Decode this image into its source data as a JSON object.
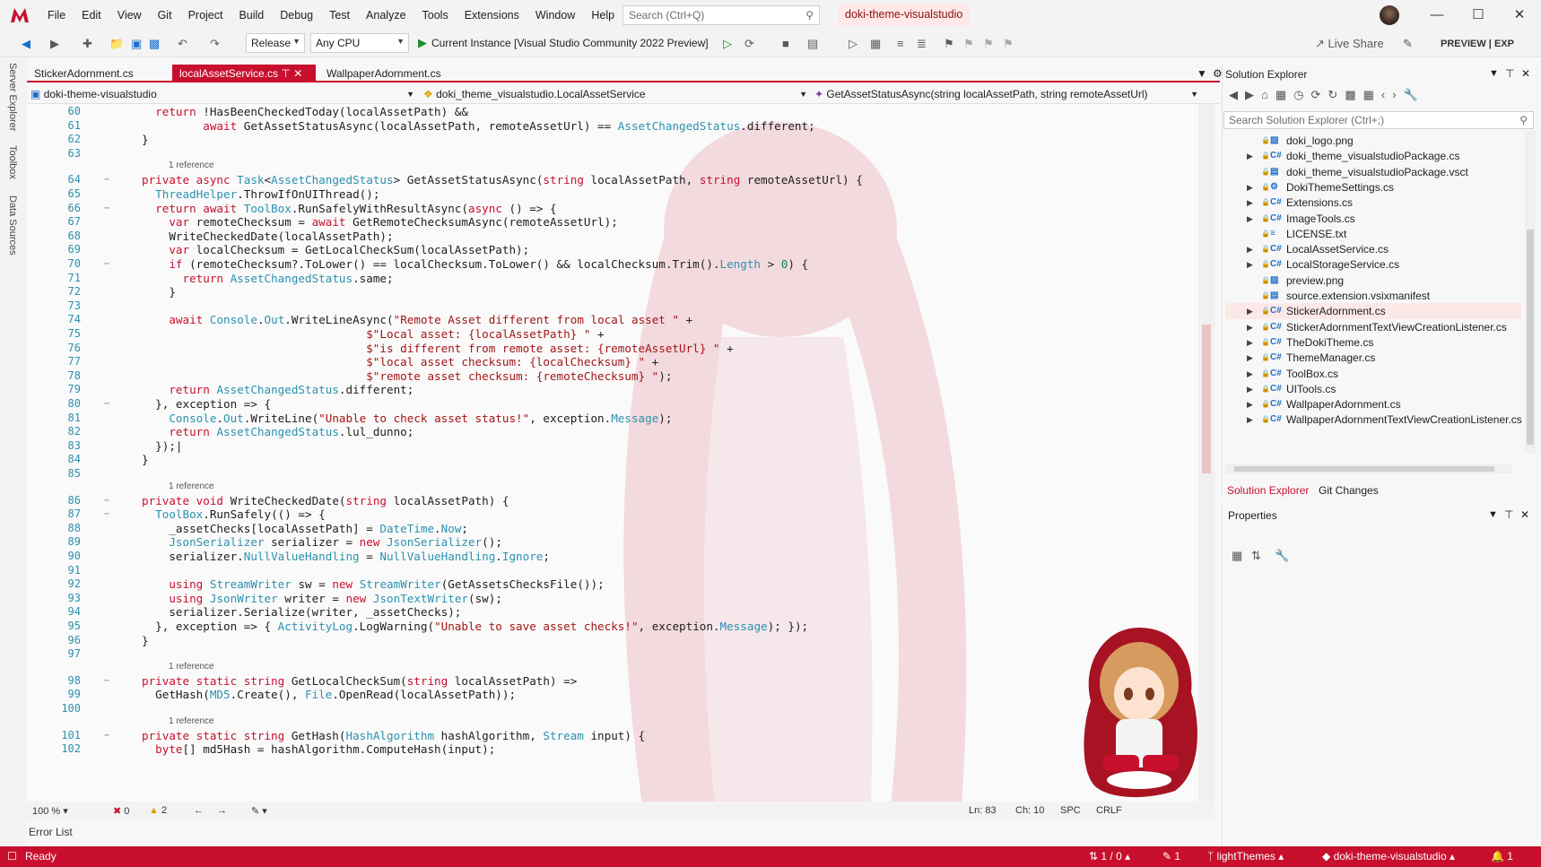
{
  "menu": [
    "File",
    "Edit",
    "View",
    "Git",
    "Project",
    "Build",
    "Debug",
    "Test",
    "Analyze",
    "Tools",
    "Extensions",
    "Window",
    "Help"
  ],
  "search": {
    "placeholder": "Search (Ctrl+Q)"
  },
  "solution_name": "doki-theme-visualstudio",
  "toolbar": {
    "config": "Release",
    "platform": "Any CPU",
    "run_target": "Current Instance [Visual Studio Community 2022 Preview]",
    "live_share": "Live Share",
    "preview": "PREVIEW",
    "exp": "EXP"
  },
  "left_tabs": [
    "Server Explorer",
    "Toolbox",
    "Data Sources"
  ],
  "doc_tabs": [
    {
      "label": "StickerAdornment.cs",
      "active": false
    },
    {
      "label": "localAssetService.cs",
      "active": true
    },
    {
      "label": "WallpaperAdornment.cs",
      "active": false
    }
  ],
  "navbar": {
    "project": "doki-theme-visualstudio",
    "type": "doki_theme_visualstudio.LocalAssetService",
    "member": "GetAssetStatusAsync(string localAssetPath, string remoteAssetUrl)"
  },
  "code_lines": [
    {
      "n": "60",
      "html": "  <span class='kw'>return</span> !HasBeenCheckedToday(localAssetPath) &amp;&amp;"
    },
    {
      "n": "61",
      "html": "         <span class='kw'>await</span> GetAssetStatusAsync(localAssetPath, remoteAssetUrl) == <span class='ty'>AssetChangedStatus</span>.different;"
    },
    {
      "n": "62",
      "html": "}"
    },
    {
      "n": "63",
      "html": ""
    },
    {
      "n": "64",
      "ref": "1 reference",
      "fold": true,
      "html": "<span class='kw'>private async</span> <span class='ty'>Task</span>&lt;<span class='ty'>AssetChangedStatus</span>&gt; GetAssetStatusAsync(<span class='kw'>string</span> localAssetPath, <span class='kw'>string</span> remoteAssetUrl) {"
    },
    {
      "n": "65",
      "html": "  <span class='ty'>ThreadHelper</span>.ThrowIfOnUIThread();"
    },
    {
      "n": "66",
      "fold": true,
      "html": "  <span class='kw'>return await</span> <span class='ty'>ToolBox</span>.RunSafelyWithResultAsync(<span class='kw'>async</span> () =&gt; {"
    },
    {
      "n": "67",
      "html": "    <span class='kw'>var</span> remoteChecksum = <span class='kw'>await</span> GetRemoteChecksumAsync(remoteAssetUrl);"
    },
    {
      "n": "68",
      "html": "    WriteCheckedDate(localAssetPath);"
    },
    {
      "n": "69",
      "html": "    <span class='kw'>var</span> localChecksum = GetLocalCheckSum(localAssetPath);"
    },
    {
      "n": "70",
      "fold": true,
      "html": "    <span class='kw'>if</span> (remoteChecksum?.ToLower() == localChecksum.ToLower() &amp;&amp; localChecksum.Trim().<span class='ty'>Length</span> &gt; <span class='num'>0</span>) {"
    },
    {
      "n": "71",
      "html": "      <span class='kw'>return</span> <span class='ty'>AssetChangedStatus</span>.same;"
    },
    {
      "n": "72",
      "html": "    }"
    },
    {
      "n": "73",
      "html": ""
    },
    {
      "n": "74",
      "html": "    <span class='kw'>await</span> <span class='ty'>Console</span>.<span class='ty'>Out</span>.WriteLineAsync(<span class='str'>\"Remote Asset different from local asset \"</span> +"
    },
    {
      "n": "75",
      "html": "                                 <span class='str'>$\"Local asset: {localAssetPath} \"</span> +"
    },
    {
      "n": "76",
      "html": "                                 <span class='str'>$\"is different from remote asset: {remoteAssetUrl} \"</span> +"
    },
    {
      "n": "77",
      "html": "                                 <span class='str'>$\"local asset checksum: {localChecksum} \"</span> +"
    },
    {
      "n": "78",
      "html": "                                 <span class='str'>$\"remote asset checksum: {remoteChecksum} \"</span>);"
    },
    {
      "n": "79",
      "html": "    <span class='kw'>return</span> <span class='ty'>AssetChangedStatus</span>.different;"
    },
    {
      "n": "80",
      "fold": true,
      "html": "  }, exception =&gt; {"
    },
    {
      "n": "81",
      "html": "    <span class='ty'>Console</span>.<span class='ty'>Out</span>.WriteLine(<span class='str'>\"Unable to check asset status!\"</span>, exception.<span class='ty'>Message</span>);"
    },
    {
      "n": "82",
      "html": "    <span class='kw'>return</span> <span class='ty'>AssetChangedStatus</span>.lul_dunno;"
    },
    {
      "n": "83",
      "html": "  });|"
    },
    {
      "n": "84",
      "html": "}"
    },
    {
      "n": "85",
      "html": ""
    },
    {
      "n": "86",
      "ref": "1 reference",
      "fold": true,
      "html": "<span class='kw'>private void</span> WriteCheckedDate(<span class='kw'>string</span> localAssetPath) {"
    },
    {
      "n": "87",
      "fold": true,
      "html": "  <span class='ty'>ToolBox</span>.RunSafely(() =&gt; {"
    },
    {
      "n": "88",
      "html": "    _assetChecks[localAssetPath] = <span class='ty'>DateTime</span>.<span class='ty'>Now</span>;"
    },
    {
      "n": "89",
      "html": "    <span class='ty'>JsonSerializer</span> serializer = <span class='kw'>new</span> <span class='ty'>JsonSerializer</span>();"
    },
    {
      "n": "90",
      "html": "    serializer.<span class='ty'>NullValueHandling</span> = <span class='ty'>NullValueHandling</span>.<span class='ty'>Ignore</span>;"
    },
    {
      "n": "91",
      "html": ""
    },
    {
      "n": "92",
      "html": "    <span class='kw'>using</span> <span class='ty'>StreamWriter</span> sw = <span class='kw'>new</span> <span class='ty'>StreamWriter</span>(GetAssetsChecksFile());"
    },
    {
      "n": "93",
      "html": "    <span class='kw'>using</span> <span class='ty'>JsonWriter</span> writer = <span class='kw'>new</span> <span class='ty'>JsonTextWriter</span>(sw);"
    },
    {
      "n": "94",
      "html": "    serializer.Serialize(writer, _assetChecks);"
    },
    {
      "n": "95",
      "html": "  }, exception =&gt; { <span class='ty'>ActivityLog</span>.LogWarning(<span class='str'>\"Unable to save asset checks!\"</span>, exception.<span class='ty'>Message</span>); });"
    },
    {
      "n": "96",
      "html": "}"
    },
    {
      "n": "97",
      "html": ""
    },
    {
      "n": "98",
      "ref": "1 reference",
      "fold": true,
      "html": "<span class='kw'>private static string</span> GetLocalCheckSum(<span class='kw'>string</span> localAssetPath) =&gt;"
    },
    {
      "n": "99",
      "html": "  GetHash(<span class='ty'>MD5</span>.Create(), <span class='ty'>File</span>.OpenRead(localAssetPath));"
    },
    {
      "n": "100",
      "html": ""
    },
    {
      "n": "101",
      "ref": "1 reference",
      "fold": true,
      "html": "<span class='kw'>private static string</span> GetHash(<span class='ty'>HashAlgorithm</span> hashAlgorithm, <span class='ty'>Stream</span> input) {"
    },
    {
      "n": "102",
      "html": "  <span class='kw'>byte</span>[] md5Hash = hashAlgorithm.ComputeHash(input);"
    }
  ],
  "editor_status": {
    "zoom": "100 %",
    "errors": "0",
    "warnings": "2",
    "line": "Ln: 83",
    "col": "Ch: 10",
    "spc": "SPC",
    "crlf": "CRLF"
  },
  "error_list_tab": "Error List",
  "solution_explorer": {
    "title": "Solution Explorer",
    "search_placeholder": "Search Solution Explorer (Ctrl+;)",
    "items": [
      {
        "name": "doki_logo.png",
        "icon": "image",
        "expandable": false
      },
      {
        "name": "doki_theme_visualstudioPackage.cs",
        "icon": "cs",
        "expandable": true
      },
      {
        "name": "doki_theme_visualstudioPackage.vsct",
        "icon": "vsct",
        "expandable": false
      },
      {
        "name": "DokiThemeSettings.cs",
        "icon": "settings",
        "expandable": true
      },
      {
        "name": "Extensions.cs",
        "icon": "cs",
        "expandable": true
      },
      {
        "name": "ImageTools.cs",
        "icon": "cs",
        "expandable": true
      },
      {
        "name": "LICENSE.txt",
        "icon": "txt",
        "expandable": false
      },
      {
        "name": "LocalAssetService.cs",
        "icon": "cs",
        "expandable": true
      },
      {
        "name": "LocalStorageService.cs",
        "icon": "cs",
        "expandable": true
      },
      {
        "name": "preview.png",
        "icon": "image",
        "expandable": false
      },
      {
        "name": "source.extension.vsixmanifest",
        "icon": "manifest",
        "expandable": false
      },
      {
        "name": "StickerAdornment.cs",
        "icon": "cs",
        "expandable": true,
        "selected": true
      },
      {
        "name": "StickerAdornmentTextViewCreationListener.cs",
        "icon": "cs",
        "expandable": true
      },
      {
        "name": "TheDokiTheme.cs",
        "icon": "cs",
        "expandable": true
      },
      {
        "name": "ThemeManager.cs",
        "icon": "cs",
        "expandable": true
      },
      {
        "name": "ToolBox.cs",
        "icon": "cs",
        "expandable": true
      },
      {
        "name": "UITools.cs",
        "icon": "cs",
        "expandable": true
      },
      {
        "name": "WallpaperAdornment.cs",
        "icon": "cs",
        "expandable": true
      },
      {
        "name": "WallpaperAdornmentTextViewCreationListener.cs",
        "icon": "cs",
        "expandable": true
      }
    ],
    "tabs": [
      "Solution Explorer",
      "Git Changes"
    ]
  },
  "properties": {
    "title": "Properties"
  },
  "statusbar": {
    "ready": "Ready",
    "sync": "1 / 0",
    "edits": "1",
    "branch": "lightThemes",
    "repo": "doki-theme-visualstudio",
    "notifications": "1"
  },
  "colors": {
    "accent": "#c8102e",
    "keyword": "#c8102e",
    "type": "#2b91af",
    "string": "#a31515"
  }
}
